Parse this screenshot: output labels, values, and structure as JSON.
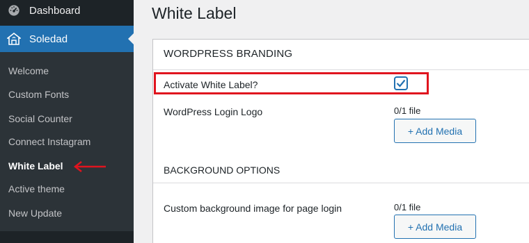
{
  "sidebar": {
    "dashboard_label": "Dashboard",
    "dashboard_icon": "dashboard-gauge-icon",
    "theme_label": "Soledad",
    "theme_icon": "home-icon",
    "submenu": [
      {
        "label": "Welcome"
      },
      {
        "label": "Custom Fonts"
      },
      {
        "label": "Social Counter"
      },
      {
        "label": "Connect Instagram"
      },
      {
        "label": "White Label",
        "current": true
      },
      {
        "label": "Active theme"
      },
      {
        "label": "New Update"
      }
    ]
  },
  "page": {
    "title": "White Label"
  },
  "panel": {
    "heading": "WORDPRESS BRANDING",
    "activate_label": "Activate White Label?",
    "activate_checked": true,
    "login_logo_label": "WordPress Login Logo",
    "login_logo_count": "0/1 file",
    "add_media_label": "+ Add Media",
    "background_heading": "BACKGROUND OPTIONS",
    "bg_image_label": "Custom background image for page login",
    "bg_image_count": "0/1 file"
  },
  "colors": {
    "sidebar_bg": "#1d2327",
    "accent": "#2271b1",
    "annotation": "#e0141e"
  }
}
